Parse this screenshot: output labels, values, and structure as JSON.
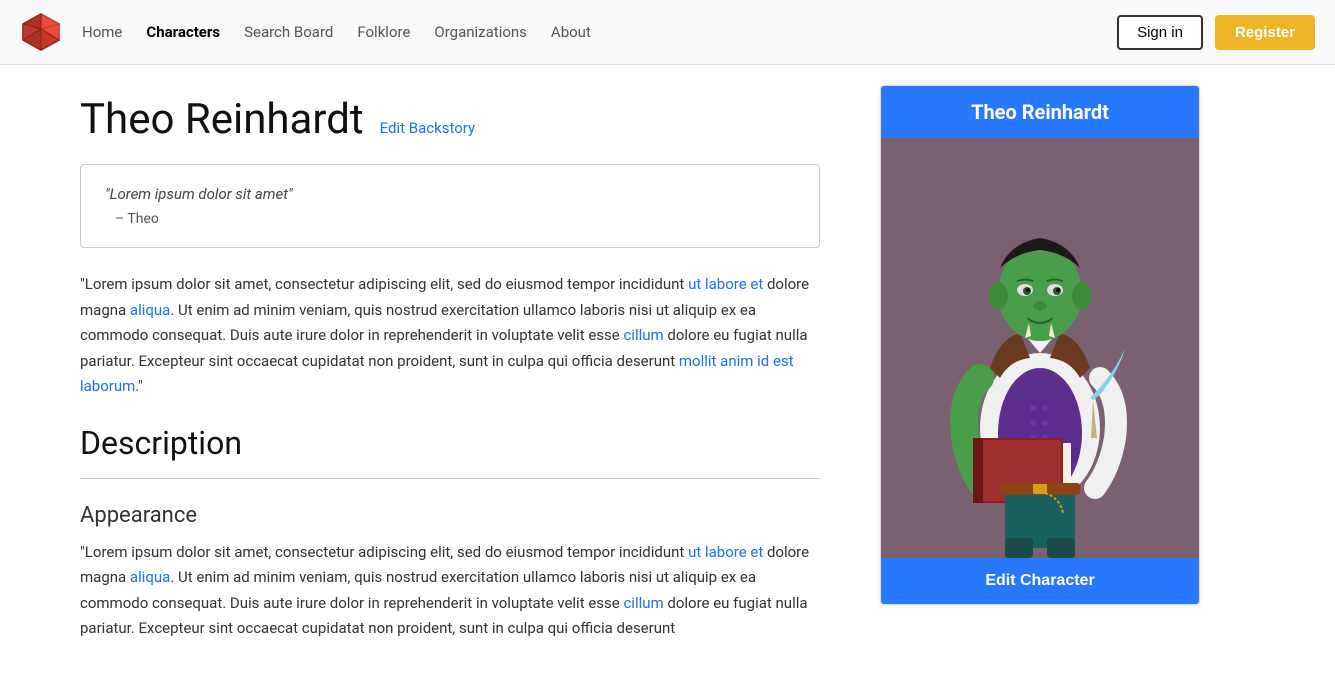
{
  "navbar": {
    "logo_alt": "Site Logo",
    "nav_items": [
      {
        "label": "Home",
        "active": false,
        "id": "home"
      },
      {
        "label": "Characters",
        "active": true,
        "id": "characters"
      },
      {
        "label": "Search Board",
        "active": false,
        "id": "search-board"
      },
      {
        "label": "Folklore",
        "active": false,
        "id": "folklore"
      },
      {
        "label": "Organizations",
        "active": false,
        "id": "organizations"
      },
      {
        "label": "About",
        "active": false,
        "id": "about"
      }
    ],
    "signin_label": "Sign in",
    "register_label": "Register"
  },
  "page": {
    "character_name": "Theo Reinhardt",
    "edit_backstory_label": "Edit Backstory",
    "quote_text": "\"Lorem ipsum dolor sit amet\"",
    "quote_attribution": "– Theo",
    "body_paragraph_1": "\"Lorem ipsum dolor sit amet, consectetur adipiscing elit, sed do eiusmod tempor incididunt ut labore et dolore magna aliqua. Ut enim ad minim veniam, quis nostrud exercitation ullamco laboris nisi ut aliquip ex ea commodo consequat. Duis aute irure dolor in reprehenderit in voluptate velit esse cillum dolore eu fugiat nulla pariatur. Excepteur sint occaecat cupidatat non proident, sunt in culpa qui officia deserunt mollit anim id est laborum.\"",
    "description_heading": "Description",
    "appearance_heading": "Appearance",
    "body_paragraph_2": "\"Lorem ipsum dolor sit amet, consectetur adipiscing elit, sed do eiusmod tempor incididunt ut labore et dolore magna aliqua. Ut enim ad minim veniam, quis nostrud exercitation ullamco laboris nisi ut aliquip ex ea commodo consequat. Duis aute irure dolor in reprehenderit in voluptate velit esse cillum dolore eu fugiat nulla pariatur. Excepteur sint occaecat cupidatat non proident, sunt in culpa qui officia deserunt"
  },
  "sidebar": {
    "card_title": "Theo Reinhardt",
    "edit_character_label": "Edit Character",
    "background_color": "#7a6070"
  },
  "colors": {
    "accent_blue": "#2979ff",
    "link_blue": "#1a73e8",
    "register_yellow": "#f0b429"
  }
}
